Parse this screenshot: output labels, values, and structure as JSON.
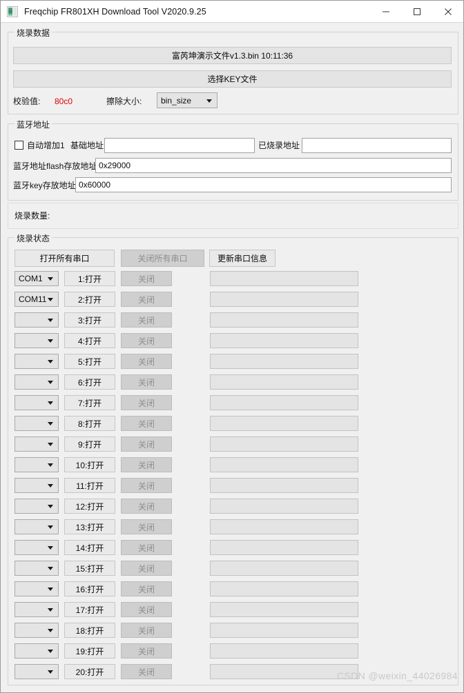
{
  "window": {
    "title": "Freqchip FR801XH Download Tool V2020.9.25",
    "icon": "app-icon",
    "controls": {
      "minimize": "minimize-icon",
      "maximize": "maximize-icon",
      "close": "close-icon"
    }
  },
  "burn_data": {
    "group_title": "烧录数据",
    "bin_file_button": "富芮坤演示文件v1.3.bin          10:11:36",
    "key_file_button": "选择KEY文件",
    "checksum_label": "校验值:",
    "checksum_value": "80c0",
    "checksum_color": "#e00000",
    "erase_size_label": "擦除大小:",
    "erase_size_value": "bin_size",
    "erase_size_options": [
      "bin_size"
    ]
  },
  "bluetooth": {
    "group_title": "蓝牙地址",
    "auto_increment_label": "自动增加1",
    "auto_increment_checked": false,
    "base_address_label": "基础地址",
    "base_address_value": "",
    "burned_address_label": "已烧录地址",
    "burned_address_value": "",
    "flash_addr_label": "蓝牙地址flash存放地址",
    "flash_addr_value": "0x29000",
    "key_addr_label": "蓝牙key存放地址",
    "key_addr_value": "0x60000"
  },
  "burn_count": {
    "label": "烧录数量:",
    "value": ""
  },
  "burn_status": {
    "group_title": "烧录状态",
    "open_all_button": "打开所有串口",
    "close_all_button": "关闭所有串口",
    "refresh_button": "更新串口信息",
    "close_all_disabled": true,
    "rows": [
      {
        "port": "COM1",
        "open": "1:打开",
        "close": "关闭",
        "status": ""
      },
      {
        "port": "COM11",
        "open": "2:打开",
        "close": "关闭",
        "status": ""
      },
      {
        "port": "",
        "open": "3:打开",
        "close": "关闭",
        "status": ""
      },
      {
        "port": "",
        "open": "4:打开",
        "close": "关闭",
        "status": ""
      },
      {
        "port": "",
        "open": "5:打开",
        "close": "关闭",
        "status": ""
      },
      {
        "port": "",
        "open": "6:打开",
        "close": "关闭",
        "status": ""
      },
      {
        "port": "",
        "open": "7:打开",
        "close": "关闭",
        "status": ""
      },
      {
        "port": "",
        "open": "8:打开",
        "close": "关闭",
        "status": ""
      },
      {
        "port": "",
        "open": "9:打开",
        "close": "关闭",
        "status": ""
      },
      {
        "port": "",
        "open": "10:打开",
        "close": "关闭",
        "status": ""
      },
      {
        "port": "",
        "open": "11:打开",
        "close": "关闭",
        "status": ""
      },
      {
        "port": "",
        "open": "12:打开",
        "close": "关闭",
        "status": ""
      },
      {
        "port": "",
        "open": "13:打开",
        "close": "关闭",
        "status": ""
      },
      {
        "port": "",
        "open": "14:打开",
        "close": "关闭",
        "status": ""
      },
      {
        "port": "",
        "open": "15:打开",
        "close": "关闭",
        "status": ""
      },
      {
        "port": "",
        "open": "16:打开",
        "close": "关闭",
        "status": ""
      },
      {
        "port": "",
        "open": "17:打开",
        "close": "关闭",
        "status": ""
      },
      {
        "port": "",
        "open": "18:打开",
        "close": "关闭",
        "status": ""
      },
      {
        "port": "",
        "open": "19:打开",
        "close": "关闭",
        "status": ""
      },
      {
        "port": "",
        "open": "20:打开",
        "close": "关闭",
        "status": ""
      }
    ]
  },
  "watermark": "CSDN @weixin_44026984"
}
